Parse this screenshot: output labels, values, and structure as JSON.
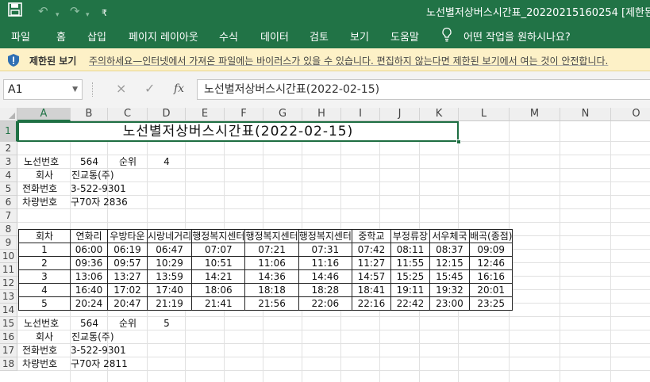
{
  "titlebar": {
    "save_icon": "save-icon",
    "undo_icon": "undo-icon",
    "redo_icon": "redo-icon",
    "customize_icon": "customize-qat-icon",
    "title": "노선별저상버스시간표_20220215160254  [제한된 보"
  },
  "ribbon": {
    "tabs": [
      "파일",
      "홈",
      "삽입",
      "페이지 레이아웃",
      "수식",
      "데이터",
      "검토",
      "보기",
      "도움말"
    ],
    "tell_me": "어떤 작업을 원하시나요?",
    "tell_me_icon": "lightbulb-icon"
  },
  "protected_view": {
    "icon": "shield-warning-icon",
    "label": "제한된 보기",
    "message": "주의하세요—인터넷에서 가져온 파일에는 바이러스가 있을 수 있습니다. 편집하지 않는다면 제한된 보기에서 여는 것이 안전합니다."
  },
  "formula_bar": {
    "name_box": "A1",
    "cancel_icon": "×",
    "enter_icon": "✓",
    "fx_label": "fx",
    "value": "노선별저상버스시간표(2022-02-15)"
  },
  "sheet": {
    "columns": [
      "A",
      "B",
      "C",
      "D",
      "E",
      "F",
      "G",
      "H",
      "I",
      "J",
      "K",
      "L",
      "M",
      "N",
      "O"
    ],
    "rows": [
      "1",
      "2",
      "3",
      "4",
      "5",
      "6",
      "7",
      "8",
      "9",
      "10",
      "11",
      "12",
      "13",
      "14",
      "15",
      "16",
      "17",
      "18"
    ],
    "selected_cell": "A1",
    "title": "노선별저상버스시간표(2022-02-15)",
    "block1": {
      "route_label": "노선번호",
      "route": "564",
      "rank_label": "순위",
      "rank": "4",
      "company_label": "회사",
      "company": "진교통(주)",
      "phone_label": "전화번호",
      "phone": "3-522-9301",
      "vehicle_label": "차량번호",
      "vehicle": "구70자 2836"
    },
    "timetable": {
      "headers": [
        "회차",
        "연화리",
        "우방타운",
        "시랑네거리",
        "행정복지센터",
        "행정복지센터",
        "행정복지센터",
        "중학교",
        "부정류장",
        "서우체국",
        "배곡(종점)"
      ],
      "rows": [
        [
          "1",
          "06:00",
          "06:19",
          "06:47",
          "07:07",
          "07:21",
          "07:31",
          "07:42",
          "08:11",
          "08:37",
          "09:09"
        ],
        [
          "2",
          "09:36",
          "09:57",
          "10:29",
          "10:51",
          "11:06",
          "11:16",
          "11:27",
          "11:55",
          "12:15",
          "12:46"
        ],
        [
          "3",
          "13:06",
          "13:27",
          "13:59",
          "14:21",
          "14:36",
          "14:46",
          "14:57",
          "15:25",
          "15:45",
          "16:16"
        ],
        [
          "4",
          "16:40",
          "17:02",
          "17:40",
          "18:06",
          "18:18",
          "18:28",
          "18:41",
          "19:11",
          "19:32",
          "20:01"
        ],
        [
          "5",
          "20:24",
          "20:47",
          "21:19",
          "21:41",
          "21:56",
          "22:06",
          "22:16",
          "22:42",
          "23:00",
          "23:25"
        ]
      ]
    },
    "block2": {
      "route_label": "노선번호",
      "route": "564",
      "rank_label": "순위",
      "rank": "5",
      "company_label": "회사",
      "company": "진교통(주)",
      "phone_label": "전화번호",
      "phone": "3-522-9301",
      "vehicle_label": "차량번호",
      "vehicle": "구70자 2811"
    }
  }
}
